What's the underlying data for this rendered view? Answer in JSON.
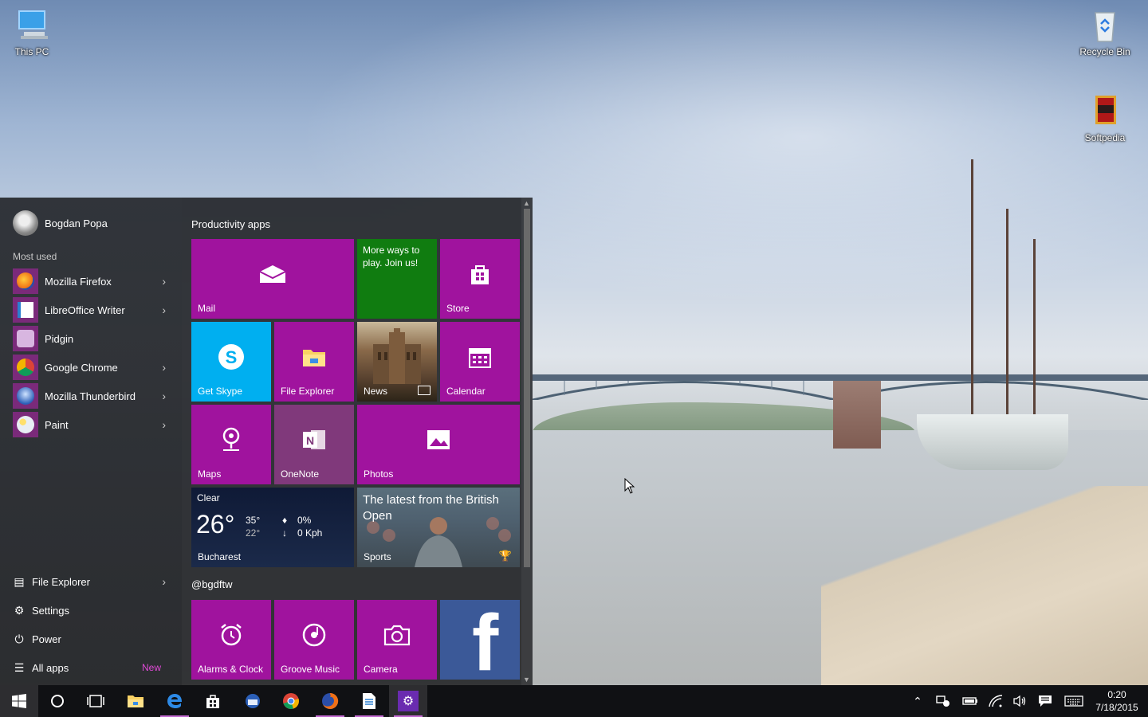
{
  "desktop": {
    "icons": [
      {
        "label": "This PC"
      },
      {
        "label": "Recycle Bin"
      },
      {
        "label": "Softpedia"
      }
    ]
  },
  "start_menu": {
    "user_name": "Bogdan Popa",
    "most_used_title": "Most used",
    "most_used": [
      {
        "label": "Mozilla Firefox",
        "icon": "firefox-icon",
        "has_submenu": true
      },
      {
        "label": "LibreOffice Writer",
        "icon": "writer-icon",
        "has_submenu": true
      },
      {
        "label": "Pidgin",
        "icon": "pidgin-icon",
        "has_submenu": false
      },
      {
        "label": "Google Chrome",
        "icon": "chrome-icon",
        "has_submenu": true
      },
      {
        "label": "Mozilla Thunderbird",
        "icon": "thunderbird-icon",
        "has_submenu": true
      },
      {
        "label": "Paint",
        "icon": "paint-icon",
        "has_submenu": true
      }
    ],
    "system": {
      "file_explorer": "File Explorer",
      "settings": "Settings",
      "power": "Power",
      "all_apps": "All apps",
      "new_badge": "New"
    },
    "groups": {
      "productivity": "Productivity apps",
      "second": "@bgdftw"
    },
    "tiles": {
      "mail": "Mail",
      "xbox_promo": "More ways to play. Join us!",
      "store": "Store",
      "skype": "Get Skype",
      "file_explorer": "File Explorer",
      "news": "News",
      "calendar": "Calendar",
      "maps": "Maps",
      "onenote": "OneNote",
      "photos": "Photos",
      "weather": {
        "condition": "Clear",
        "temp": "26°",
        "high": "35°",
        "low": "22°",
        "precip": "0%",
        "wind": "0 Kph",
        "city": "Bucharest"
      },
      "sports": {
        "headline": "The latest from the British Open",
        "label": "Sports"
      },
      "alarms": "Alarms & Clock",
      "groove": "Groove Music",
      "camera": "Camera",
      "facebook": "f"
    },
    "colors": {
      "tile": "#a0139e",
      "xbox": "#107c10",
      "skype": "#00aff0",
      "onenote": "#80397b",
      "facebook": "#3b5998"
    }
  },
  "taskbar": {
    "clock_time": "0:20",
    "clock_date": "7/18/2015"
  }
}
